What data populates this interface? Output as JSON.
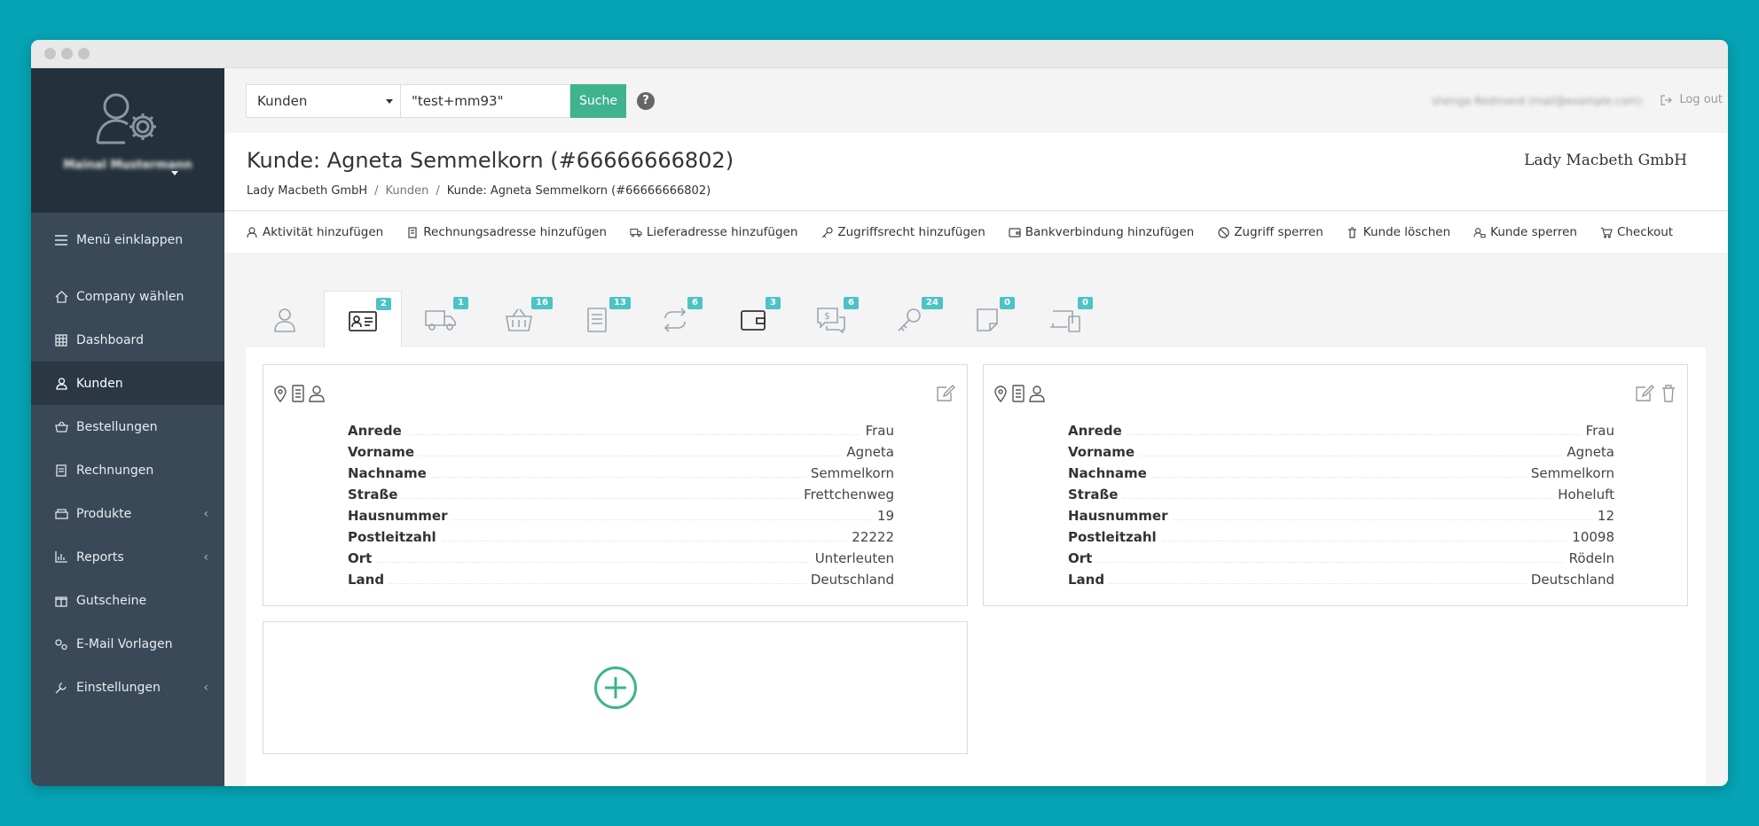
{
  "sidebar": {
    "profile_name": "Mainal Mustermann",
    "collapse_label": "Menü einklappen",
    "items": [
      {
        "label": "Company wählen"
      },
      {
        "label": "Dashboard"
      },
      {
        "label": "Kunden"
      },
      {
        "label": "Bestellungen"
      },
      {
        "label": "Rechnungen"
      },
      {
        "label": "Produkte"
      },
      {
        "label": "Reports"
      },
      {
        "label": "Gutscheine"
      },
      {
        "label": "E-Mail Vorlagen"
      },
      {
        "label": "Einstellungen"
      }
    ]
  },
  "search": {
    "scope": "Kunden",
    "query": "\"test+mm93\"",
    "button": "Suche",
    "help": "?"
  },
  "topbar": {
    "user_info": "shenga Redmond (mail@example.com)",
    "logout": "Log out"
  },
  "header": {
    "title": "Kunde: Agneta Semmelkorn (#66666666802)",
    "company": "Lady Macbeth GmbH",
    "breadcrumb": [
      "Lady Macbeth GmbH",
      "Kunden",
      "Kunde: Agneta Semmelkorn (#66666666802)"
    ]
  },
  "toolbar": {
    "activity": "Aktivität hinzufügen",
    "billing": "Rechnungsadresse hinzufügen",
    "shipping": "Lieferadresse hinzufügen",
    "access": "Zugriffsrecht hinzufügen",
    "bank": "Bankverbindung hinzufügen",
    "block_access": "Zugriff sperren",
    "delete": "Kunde löschen",
    "lock": "Kunde sperren",
    "checkout": "Checkout"
  },
  "tabs": [
    {
      "icon": "user-icon",
      "badge": ""
    },
    {
      "icon": "id-card-icon",
      "badge": "2"
    },
    {
      "icon": "truck-icon",
      "badge": "1"
    },
    {
      "icon": "basket-icon",
      "badge": "16"
    },
    {
      "icon": "invoice-icon",
      "badge": "13"
    },
    {
      "icon": "repeat-icon",
      "badge": "6"
    },
    {
      "icon": "wallet-icon",
      "badge": "3"
    },
    {
      "icon": "money-chat-icon",
      "badge": "6"
    },
    {
      "icon": "key-icon",
      "badge": "24"
    },
    {
      "icon": "note-icon",
      "badge": "0"
    },
    {
      "icon": "devices-icon",
      "badge": "0"
    }
  ],
  "addresses": [
    {
      "rows": [
        {
          "k": "Anrede",
          "v": "Frau"
        },
        {
          "k": "Vorname",
          "v": "Agneta"
        },
        {
          "k": "Nachname",
          "v": "Semmelkorn"
        },
        {
          "k": "Straße",
          "v": "Frettchenweg"
        },
        {
          "k": "Hausnummer",
          "v": "19"
        },
        {
          "k": "Postleitzahl",
          "v": "22222"
        },
        {
          "k": "Ort",
          "v": "Unterleuten"
        },
        {
          "k": "Land",
          "v": "Deutschland"
        }
      ]
    },
    {
      "rows": [
        {
          "k": "Anrede",
          "v": "Frau"
        },
        {
          "k": "Vorname",
          "v": "Agneta"
        },
        {
          "k": "Nachname",
          "v": "Semmelkorn"
        },
        {
          "k": "Straße",
          "v": "Hoheluft"
        },
        {
          "k": "Hausnummer",
          "v": "12"
        },
        {
          "k": "Postleitzahl",
          "v": "10098"
        },
        {
          "k": "Ort",
          "v": "Rödeln"
        },
        {
          "k": "Land",
          "v": "Deutschland"
        }
      ]
    }
  ],
  "colors": {
    "accent": "#3fb38e",
    "badge": "#4cc3c6",
    "sidebar": "#3a4957"
  }
}
